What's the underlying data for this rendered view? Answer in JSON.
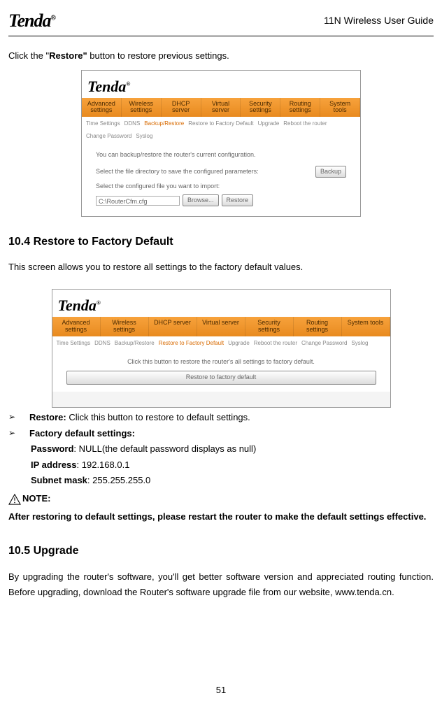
{
  "header": {
    "logo_text": "Tenda",
    "logo_sup": "®",
    "guide_title_prefix": "11N Wireless ",
    "guide_title_suffix": "User Guide"
  },
  "intro_line_prefix": "Click the \"",
  "intro_line_bold": "Restore\"",
  "intro_line_suffix": " button to restore previous settings.",
  "shot1": {
    "logo": "Tenda",
    "logo_sup": "®",
    "tabs": [
      "Advanced settings",
      "Wireless settings",
      "DHCP server",
      "Virtual server",
      "Security settings",
      "Routing settings",
      "System tools"
    ],
    "subtabs_before": [
      "Time Settings",
      "DDNS"
    ],
    "subtab_active": "Backup/Restore",
    "subtabs_after": [
      "Restore to Factory Default",
      "Upgrade",
      "Reboot the router",
      "Change Password",
      "Syslog"
    ],
    "body_line1": "You can backup/restore the router's current configuration.",
    "body_line2": "Select the file directory to save the configured parameters:",
    "backup_btn": "Backup",
    "body_line3": "Select the configured file you want to import:",
    "path_value": "C:\\RouterCfm.cfg",
    "browse_btn": "Browse...",
    "restore_btn": "Restore"
  },
  "section_104": "10.4 Restore to Factory Default",
  "section_104_para": "This screen allows you to restore all settings to the factory default values.",
  "shot2": {
    "logo": "Tenda",
    "logo_sup": "®",
    "tabs": [
      "Advanced settings",
      "Wireless settings",
      "DHCP server",
      "Virtual server",
      "Security settings",
      "Routing settings",
      "System tools"
    ],
    "subtabs_before": [
      "Time Settings",
      "DDNS",
      "Backup/Restore"
    ],
    "subtab_active": "Restore to Factory Default",
    "subtabs_after": [
      "Upgrade",
      "Reboot the router",
      "Change Password",
      "Syslog"
    ],
    "body_line": "Click this button to restore the router's all settings to factory default.",
    "restore_btn": "Restore to factory default"
  },
  "bullets": {
    "b1_label": "Restore:",
    "b1_text": " Click this button to restore to default settings.",
    "b2_label": "Factory default settings:",
    "b2_sub1_label": "Password",
    "b2_sub1_text": ": NULL(the default password displays as null)",
    "b2_sub2_label": "IP address",
    "b2_sub2_text": ": 192.168.0.1",
    "b2_sub3_label": "Subnet mask",
    "b2_sub3_text": ": 255.255.255.0"
  },
  "note_label": "NOTE:",
  "note_body": "After restoring to default settings, please restart the router to make the default settings effective.",
  "section_105": "10.5 Upgrade",
  "section_105_para": "By upgrading the router's software, you'll get better software version and appreciated routing function. Before upgrading, download the Router's software upgrade file from our website, www.tenda.cn.",
  "page_number": "51"
}
